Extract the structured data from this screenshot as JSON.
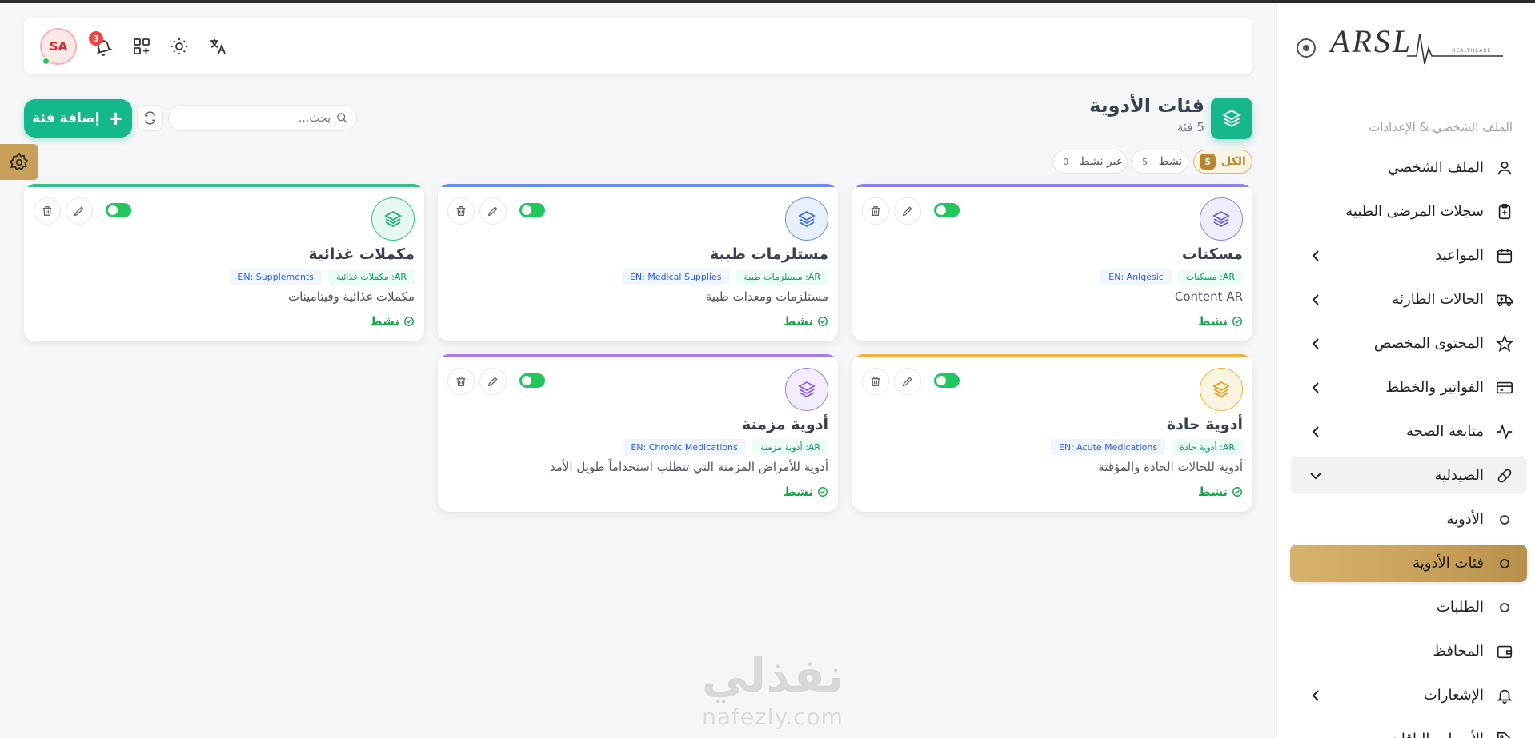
{
  "header": {
    "avatar_initials": "SA",
    "notification_count": "3"
  },
  "sidebar": {
    "logo_text": "ARSL",
    "logo_sub": "HEALTHCARE",
    "section_heading": "الملف الشخصي & الإعدادات",
    "items": [
      {
        "label": "الملف الشخصي",
        "icon": "user-icon"
      },
      {
        "label": "سجلات المرضى الطبية",
        "icon": "clipboard-icon"
      },
      {
        "label": "المواعيد",
        "icon": "calendar-icon"
      },
      {
        "label": "الحالات الطارئة",
        "icon": "ambulance-icon"
      },
      {
        "label": "المحتوى المخصص",
        "icon": "star-icon"
      },
      {
        "label": "الفواتير والخطط",
        "icon": "credit-card-icon"
      },
      {
        "label": "متابعة الصحة",
        "icon": "pulse-icon"
      },
      {
        "label": "الصيدلية",
        "icon": "pill-icon"
      },
      {
        "label": "الأدوية",
        "icon": "circle-icon"
      },
      {
        "label": "فئات الأدوية",
        "icon": "circle-icon"
      },
      {
        "label": "الطلبات",
        "icon": "circle-icon"
      },
      {
        "label": "المحافظ",
        "icon": "wallet-icon"
      },
      {
        "label": "الإشعارات",
        "icon": "bell-icon"
      },
      {
        "label": "الأسعار والباقات",
        "icon": "tag-icon"
      }
    ]
  },
  "page": {
    "title": "فئات الأدوية",
    "count": "5 فئة",
    "add_label": "إضافة فئة",
    "search_placeholder": "بحث..."
  },
  "filters": [
    {
      "label": "الكل",
      "count": "5"
    },
    {
      "label": "نشط",
      "count": "5"
    },
    {
      "label": "غير نشط",
      "count": "0"
    }
  ],
  "colors": {
    "primary": "#14b88a",
    "gold": "#c9a05a",
    "danger": "#ef4444"
  },
  "cards": [
    {
      "name": "مسكنات",
      "ar_tag": "AR: مسكنات",
      "en_tag": "EN: Anlgesic",
      "desc": "Content AR",
      "status": "نشط",
      "accent": "#8b84e8",
      "icon_bg": "#eeedfc",
      "icon_color": "#6d63d9"
    },
    {
      "name": "مستلزمات طبية",
      "ar_tag": "AR: مستلزمات طبية",
      "en_tag": "EN: Medical Supplies",
      "desc": "مستلزمات ومعدات طبية",
      "status": "نشط",
      "accent": "#6a8ee8",
      "icon_bg": "#e9f0fd",
      "icon_color": "#3b6fd9"
    },
    {
      "name": "مكملات غذائية",
      "ar_tag": "AR: مكملات غذائية",
      "en_tag": "EN: Supplements",
      "desc": "مكملات غذائية وفيتامينات",
      "status": "نشط",
      "accent": "#34c08a",
      "icon_bg": "#e6f8f0",
      "icon_color": "#14a877"
    },
    {
      "name": "أدوية حادة",
      "ar_tag": "AR: أدوية حادة",
      "en_tag": "EN: Acute Medications",
      "desc": "أدوية للحالات الحادة والمؤقتة",
      "status": "نشط",
      "accent": "#f3b13a",
      "icon_bg": "#fdf4e3",
      "icon_color": "#e0a020"
    },
    {
      "name": "أدوية مزمنة",
      "ar_tag": "AR: أدوية مزمنة",
      "en_tag": "EN: Chronic Medications",
      "desc": "أدوية للأمراض المزمنة التي تتطلب استخداماً طويل الأمد",
      "status": "نشط",
      "accent": "#a47be8",
      "icon_bg": "#f3edfd",
      "icon_color": "#8b5cf6"
    }
  ],
  "watermark": {
    "ar": "نفذلي",
    "en": "nafezly.com"
  }
}
